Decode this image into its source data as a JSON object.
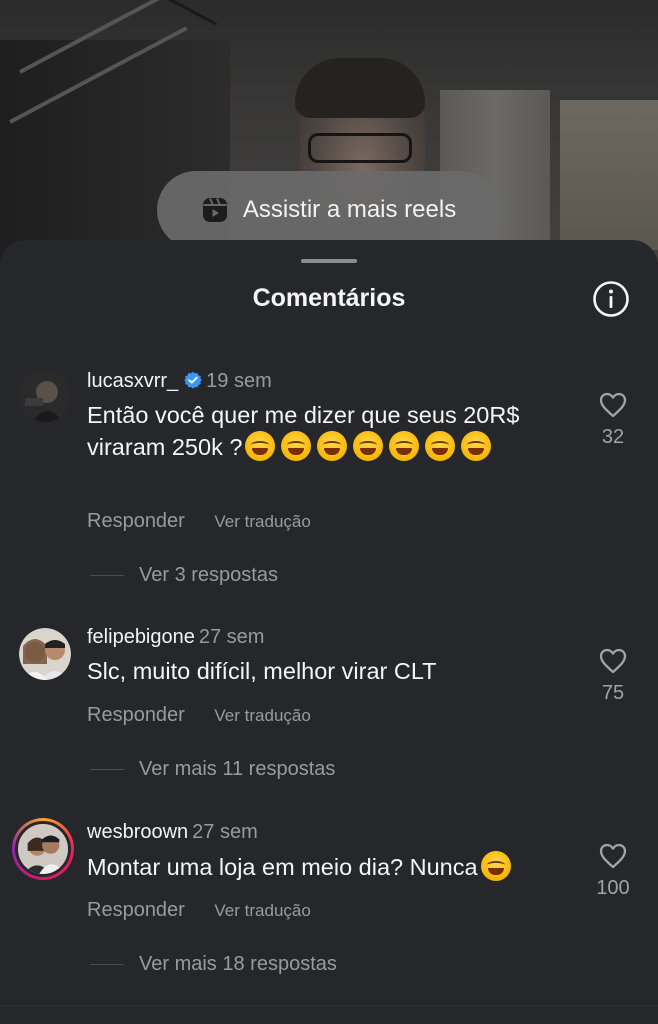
{
  "banner": {
    "label": "Assistir a mais reels",
    "icon": "reels-icon"
  },
  "sheet": {
    "title": "Comentários",
    "info_icon": "info-icon"
  },
  "comments": [
    {
      "username": "lucasxvrr_",
      "verified": true,
      "time": "19 sem",
      "text": "Então você quer me  dizer que seus 20R$ viraram 250k ?",
      "emoji_count": 7,
      "reply_label": "Responder",
      "translate_label": "Ver tradução",
      "replies_label": "Ver 3 respostas",
      "likes": "32"
    },
    {
      "username": "felipebigone",
      "verified": false,
      "time": "27 sem",
      "text": "Slc, muito difícil, melhor virar CLT",
      "emoji_count": 0,
      "reply_label": "Responder",
      "translate_label": "Ver tradução",
      "replies_label": "Ver mais 11 respostas",
      "likes": "75"
    },
    {
      "username": "wesbroown",
      "verified": false,
      "time": "27 sem",
      "text": "Montar uma loja em meio dia? Nunca",
      "emoji_count": 1,
      "reply_label": "Responder",
      "translate_label": "Ver tradução",
      "replies_label": "Ver mais 18 respostas",
      "likes": "100"
    }
  ],
  "colors": {
    "background": "#26272a",
    "verified": "#3897f0",
    "secondary_text": "#9a9a9e"
  }
}
